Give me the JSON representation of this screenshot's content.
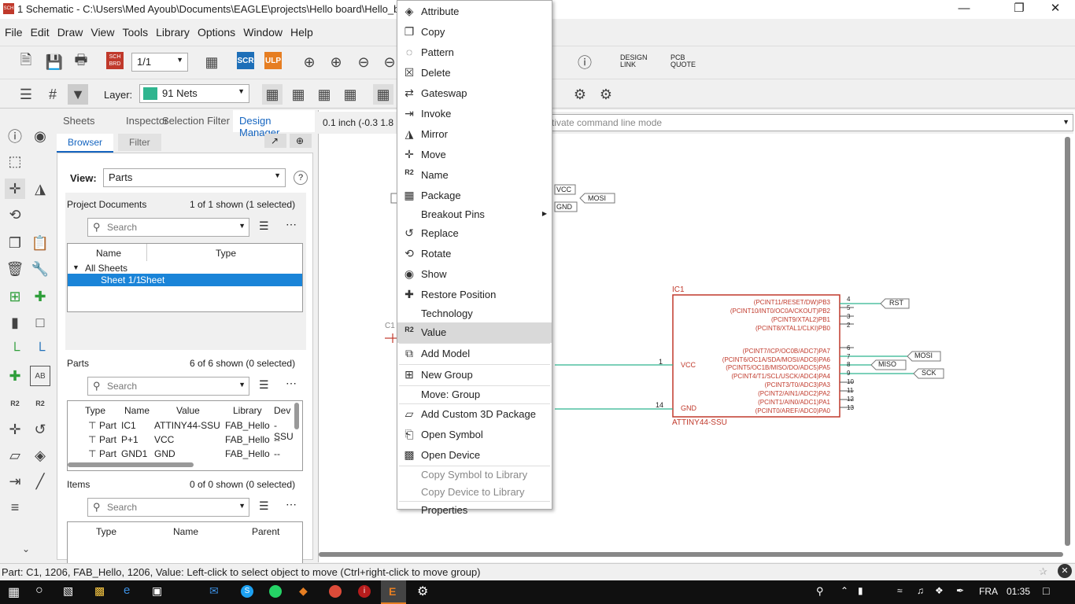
{
  "window": {
    "title": "1 Schematic - C:\\Users\\Med Ayoub\\Documents\\EAGLE\\projects\\Hello board\\Hello_board.s",
    "app_icon_text": "SCH"
  },
  "menubar": [
    "File",
    "Edit",
    "Draw",
    "View",
    "Tools",
    "Library",
    "Options",
    "Window",
    "Help"
  ],
  "toolbar": {
    "sheet_value": "1/1",
    "scr_label": "SCR",
    "ulp_label": "ULP",
    "sch_brd_label": "SCH BRD",
    "design_link_label": "DESIGN LINK",
    "pcb_quote_label": "PCB QUOTE",
    "layer_label": "Layer:",
    "layer_value": "91 Nets",
    "layer_color": "#2fb58f",
    "command_placeholder": "ctivate command line mode",
    "coordinate_readout": "0.1 inch (-0.3 1.8"
  },
  "panel": {
    "tabs": [
      "Sheets",
      "Inspector",
      "Selection Filter",
      "Design Manager"
    ],
    "active_tab": "Design Manager",
    "subtabs": [
      "Browser",
      "Filter"
    ],
    "view_label": "View:",
    "view_value": "Parts",
    "project_documents": {
      "title": "Project Documents",
      "count": "1 of 1 shown (1 selected)",
      "search_placeholder": "Search",
      "columns": [
        "Name",
        "Type"
      ],
      "group": "All Sheets",
      "row_name": "Sheet 1/1",
      "row_type": "Sheet"
    },
    "parts": {
      "title": "Parts",
      "count": "6 of 6 shown (0 selected)",
      "search_placeholder": "Search",
      "columns": [
        "Type",
        "Name",
        "Value",
        "Library",
        "Dev"
      ],
      "rows": [
        {
          "type": "Part",
          "name": "IC1",
          "value": "ATTINY44-SSU",
          "library": "FAB_Hello",
          "dev": "-SSU"
        },
        {
          "type": "Part",
          "name": "P+1",
          "value": "VCC",
          "library": "FAB_Hello",
          "dev": "--"
        },
        {
          "type": "Part",
          "name": "GND1",
          "value": "GND",
          "library": "FAB_Hello",
          "dev": "--"
        }
      ]
    },
    "items": {
      "title": "Items",
      "count": "0 of 0 shown (0 selected)",
      "search_placeholder": "Search",
      "columns": [
        "Type",
        "Name",
        "Parent"
      ]
    }
  },
  "context_menu": [
    {
      "label": "Attribute",
      "icon": "attribute-icon",
      "glyph": "◈"
    },
    {
      "label": "Copy",
      "icon": "copy-icon",
      "glyph": "❐"
    },
    {
      "label": "Pattern",
      "icon": "pattern-icon",
      "glyph": "◌"
    },
    {
      "label": "Delete",
      "icon": "delete-icon",
      "glyph": "☒"
    },
    {
      "label": "Gateswap",
      "icon": "gateswap-icon",
      "glyph": "⇄"
    },
    {
      "label": "Invoke",
      "icon": "invoke-icon",
      "glyph": "⇥"
    },
    {
      "label": "Mirror",
      "icon": "mirror-icon",
      "glyph": "◮"
    },
    {
      "label": "Move",
      "icon": "move-icon",
      "glyph": "✛"
    },
    {
      "label": "Name",
      "icon": "name-icon",
      "glyph": "R2"
    },
    {
      "label": "Package",
      "icon": "package-icon",
      "glyph": "▦"
    },
    {
      "label": "Breakout Pins",
      "icon": "",
      "glyph": ""
    },
    {
      "label": "Replace",
      "icon": "replace-icon",
      "glyph": "↺"
    },
    {
      "label": "Rotate",
      "icon": "rotate-icon",
      "glyph": "⟲"
    },
    {
      "label": "Show",
      "icon": "show-icon",
      "glyph": "◉"
    },
    {
      "label": "Restore Position",
      "icon": "restore-position-icon",
      "glyph": "✚"
    },
    {
      "label": "Technology",
      "icon": "",
      "glyph": ""
    },
    {
      "label": "Value",
      "icon": "value-icon",
      "glyph": "R2"
    },
    {
      "label": "Add Model",
      "icon": "add-model-icon",
      "glyph": "⧉"
    },
    {
      "label": "New Group",
      "icon": "new-group-icon",
      "glyph": "⊞"
    },
    {
      "label": "Move: Group",
      "icon": "",
      "glyph": ""
    },
    {
      "label": "Add Custom 3D Package",
      "icon": "add-3d-package-icon",
      "glyph": "▱"
    },
    {
      "label": "Open Symbol",
      "icon": "open-symbol-icon",
      "glyph": "⎗"
    },
    {
      "label": "Open Device",
      "icon": "open-device-icon",
      "glyph": "▩"
    },
    {
      "label": "Copy Symbol to Library",
      "icon": "",
      "glyph": ""
    },
    {
      "label": "Copy Device to Library",
      "icon": "",
      "glyph": ""
    },
    {
      "label": "Properties",
      "icon": "",
      "glyph": ""
    }
  ],
  "schematic": {
    "ic_name": "IC1",
    "ic_value": "ATTINY44-SSU",
    "c1_label": "C1",
    "vcc_pin": "VCC",
    "gnd_pin": "GND",
    "pin_numbers_right": [
      "4",
      "5",
      "3",
      "2",
      "6",
      "7",
      "8",
      "9",
      "10",
      "11",
      "12",
      "13"
    ],
    "pin_names_right": [
      "(PCINT11/RESET/DW)PB3",
      "(PCINT10/INT0/OC0A/CKOUT)PB2",
      "(PCINT9/XTAL2)PB1",
      "(PCINT8/XTAL1/CLKI)PB0",
      "(PCINT7/ICP/OC0B/ADC7)PA7",
      "(PCINT6/OC1A/SDA/MOSI/ADC6)PA6",
      "(PCINT5/OC1B/MISO/DO/ADC5)PA5",
      "(PCINT4/T1/SCL/USCK/ADC4)PA4",
      "(PCINT3/T0/ADC3)PA3",
      "(PCINT2/AIN1/ADC2)PA2",
      "(PCINT1/AIN0/ADC1)PA1",
      "(PCINT0/AREF/ADC0)PA0"
    ],
    "vcc_pin_number": "1",
    "gnd_pin_number": "14",
    "net_labels": {
      "rst": "RST",
      "mosi": "MOSI",
      "miso": "MISO",
      "sck": "SCK",
      "vcc": "VCC",
      "gnd": "GND",
      "mosi_top": "MOSI"
    }
  },
  "status": "Part: C1, 1206, FAB_Hello, 1206, Value:  Left-click to select object to move (Ctrl+right-click to move group)",
  "taskbar": {
    "language": "FRA",
    "time": "01:35"
  }
}
